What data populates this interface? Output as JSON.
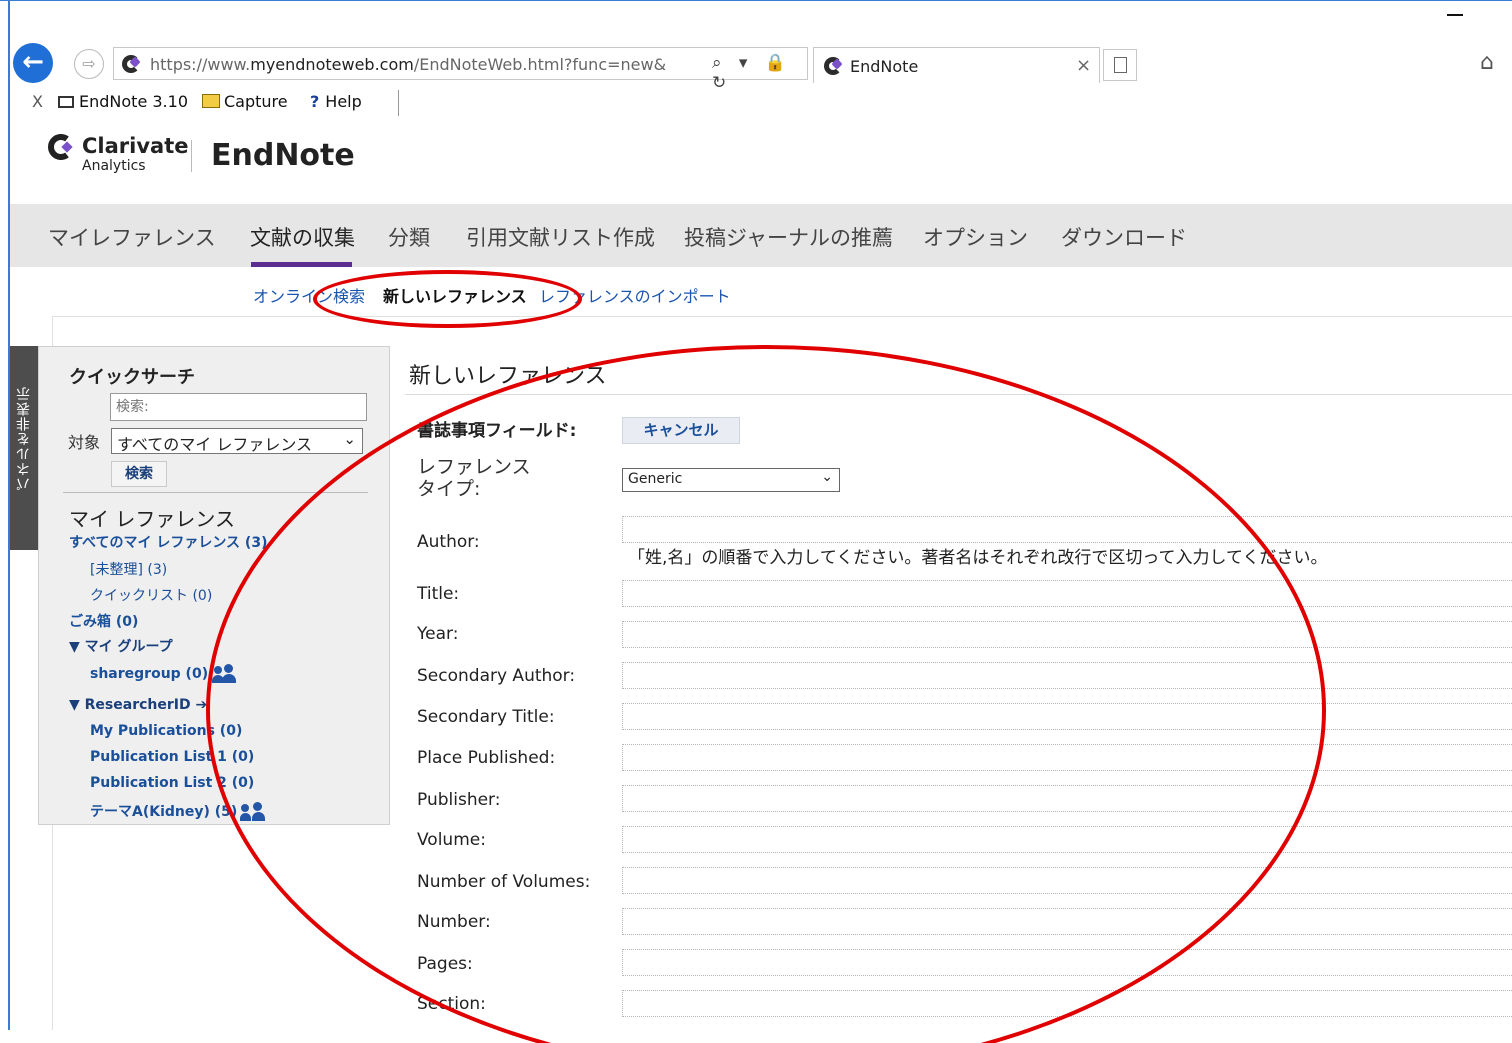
{
  "browser": {
    "url_prefix": "https://www.",
    "url_domain": "myendnoteweb.com",
    "url_path": "/EndNoteWeb.html?func=new&",
    "tab_title": "EndNote",
    "tab_close": "×",
    "address_tools": "⌕ ▾ 🔒 ↻"
  },
  "favorites": {
    "close": "X",
    "endnote": "EndNote 3.10",
    "capture": "Capture",
    "help_icon": "?",
    "help": "Help"
  },
  "brand": {
    "name": "Clarivate",
    "sub": "Analytics",
    "product": "EndNote"
  },
  "nav": {
    "items": [
      "マイレファレンス",
      "文献の収集",
      "分類",
      "引用文献リスト作成",
      "投稿ジャーナルの推薦",
      "オプション",
      "ダウンロード"
    ]
  },
  "subnav": {
    "online_search": "オンライン検索",
    "new_reference": "新しいレファレンス",
    "import": "レファレンスのインポート"
  },
  "side_tab": "パネルを非表示",
  "quick_search": {
    "title": "クイックサーチ",
    "placeholder": "検索:",
    "in_label": "対象",
    "scope": "すべてのマイ レファレンス",
    "button": "検索"
  },
  "my_refs": {
    "title": "マイ レファレンス",
    "all": "すべてのマイ レファレンス (3)",
    "unfiled": "[未整理] (3)",
    "quicklist": "クイックリスト (0)",
    "trash": "ごみ箱 (0)",
    "my_groups": "▼ マイ グループ",
    "sharegroup": "sharegroup (0)",
    "researcher": "▼ ResearcherID",
    "researcher_arrow": "➔",
    "my_publications": "My Publications (0)",
    "pub_list_1": "Publication List 1 (0)",
    "pub_list_2": "Publication List 2 (0)",
    "theme": "テーマA(Kidney) (5)"
  },
  "form": {
    "title": "新しいレファレンス",
    "bib_label": "書誌事項フィールド:",
    "cancel": "キャンセル",
    "ref_type_label": "レファレンス\nタイプ:",
    "ref_type_value": "Generic",
    "author_hint": "「姓,名」の順番で入力してください。著者名はそれぞれ改行で区切って入力してください。",
    "fields": [
      "Author:",
      "Title:",
      "Year:",
      "Secondary Author:",
      "Secondary Title:",
      "Place Published:",
      "Publisher:",
      "Volume:",
      "Number of Volumes:",
      "Number:",
      "Pages:",
      "Section:"
    ]
  },
  "colors": {
    "accent": "#5c2d91",
    "link": "#1a56b0",
    "annotation": "#e00000"
  }
}
